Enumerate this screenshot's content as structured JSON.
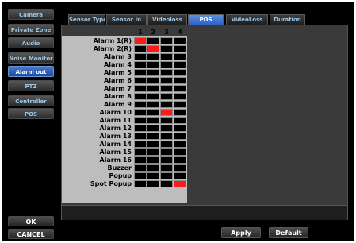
{
  "menu": {
    "items": [
      {
        "label": "Camera",
        "active": false
      },
      {
        "label": "Private Zone",
        "active": false
      },
      {
        "label": "Audio",
        "active": false
      },
      {
        "label": "Noise Monitor",
        "active": false
      },
      {
        "label": "Alarm out",
        "active": true
      },
      {
        "label": "PTZ",
        "active": false
      },
      {
        "label": "Controller",
        "active": false
      },
      {
        "label": "POS",
        "active": false
      }
    ],
    "ok_label": "OK",
    "cancel_label": "CANCEL"
  },
  "tabs": [
    {
      "label": "Sensor Type",
      "active": false
    },
    {
      "label": "Sensor In",
      "active": false
    },
    {
      "label": "Videoloss",
      "active": false
    },
    {
      "label": "POS",
      "active": true
    },
    {
      "label": "VideoLoss",
      "active": false
    },
    {
      "label": "Duration",
      "active": false
    }
  ],
  "grid": {
    "columns": [
      "1",
      "2",
      "3",
      "4"
    ],
    "rows": [
      {
        "label": "Alarm 1(R)",
        "on": [
          1,
          0,
          0,
          0
        ]
      },
      {
        "label": "Alarm 2(R)",
        "on": [
          0,
          1,
          0,
          0
        ]
      },
      {
        "label": "Alarm 3",
        "on": [
          0,
          0,
          0,
          0
        ]
      },
      {
        "label": "Alarm 4",
        "on": [
          0,
          0,
          0,
          0
        ]
      },
      {
        "label": "Alarm 5",
        "on": [
          0,
          0,
          0,
          0
        ]
      },
      {
        "label": "Alarm 6",
        "on": [
          0,
          0,
          0,
          0
        ]
      },
      {
        "label": "Alarm 7",
        "on": [
          0,
          0,
          0,
          0
        ]
      },
      {
        "label": "Alarm 8",
        "on": [
          0,
          0,
          0,
          0
        ]
      },
      {
        "label": "Alarm 9",
        "on": [
          0,
          0,
          0,
          0
        ]
      },
      {
        "label": "Alarm 10",
        "on": [
          0,
          0,
          1,
          0
        ]
      },
      {
        "label": "Alarm 11",
        "on": [
          0,
          0,
          0,
          0
        ]
      },
      {
        "label": "Alarm 12",
        "on": [
          0,
          0,
          0,
          0
        ]
      },
      {
        "label": "Alarm 13",
        "on": [
          0,
          0,
          0,
          0
        ]
      },
      {
        "label": "Alarm 14",
        "on": [
          0,
          0,
          0,
          0
        ]
      },
      {
        "label": "Alarm 15",
        "on": [
          0,
          0,
          0,
          0
        ]
      },
      {
        "label": "Alarm 16",
        "on": [
          0,
          0,
          0,
          0
        ]
      },
      {
        "label": "Buzzer",
        "on": [
          0,
          0,
          0,
          0
        ]
      },
      {
        "label": "Popup",
        "on": [
          0,
          0,
          0,
          0
        ]
      },
      {
        "label": "Spot Popup",
        "on": [
          0,
          0,
          0,
          1
        ]
      }
    ],
    "on_color": "#ff1a1a"
  },
  "actions": {
    "apply_label": "Apply",
    "default_label": "Default"
  }
}
